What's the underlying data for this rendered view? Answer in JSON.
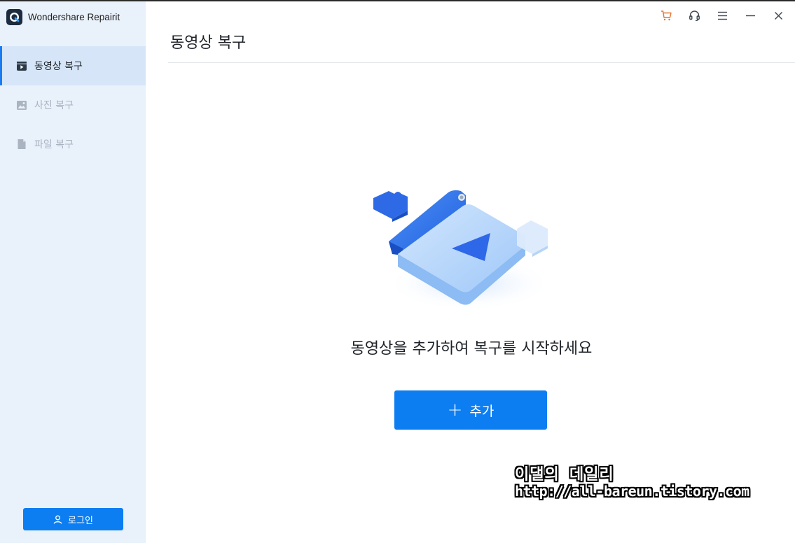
{
  "app": {
    "title": "Wondershare Repairit"
  },
  "sidebar": {
    "items": [
      {
        "label": "동영상 복구",
        "icon": "video-file-icon",
        "active": true
      },
      {
        "label": "사진 복구",
        "icon": "image-icon",
        "active": false
      },
      {
        "label": "파일 복구",
        "icon": "document-icon",
        "active": false
      }
    ],
    "login_label": "로그인"
  },
  "titlebar": {
    "icons": [
      "cart-icon",
      "headset-icon",
      "menu-icon",
      "minimize-icon",
      "close-icon"
    ],
    "cart_color": "#e8742c"
  },
  "main": {
    "title": "동영상 복구",
    "prompt": "동영상을 추가하여 복구를 시작하세요",
    "add_label": "추가",
    "add_plus": "+"
  },
  "watermark": {
    "line1": "이댈의 데일리",
    "line2": "http://all-bareun.tistory.com"
  },
  "colors": {
    "accent": "#0c7ef2",
    "sidebar_bg": "#e9f1fb",
    "sidebar_active": "#d6e6f8"
  }
}
